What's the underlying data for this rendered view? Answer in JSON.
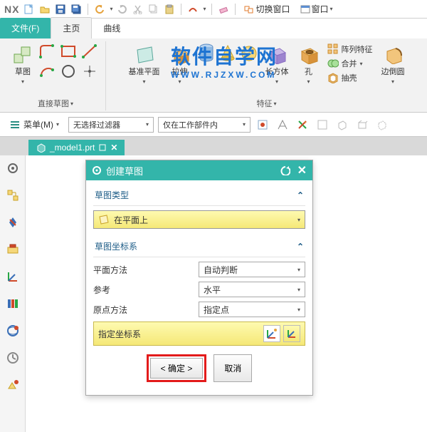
{
  "app": {
    "name": "NX"
  },
  "titlebar": {
    "switch_window": "切换窗口",
    "window_menu": "窗口"
  },
  "tabs": {
    "file": "文件(F)",
    "home": "主页",
    "curve": "曲线"
  },
  "ribbon": {
    "sketch": {
      "label": "草图",
      "direct_sketch": "直接草图"
    },
    "datum": {
      "label": "基准平面"
    },
    "extrude": {
      "label": "拉伸"
    },
    "cuboid": {
      "label": "长方体"
    },
    "hole": {
      "label": "孔"
    },
    "pattern": {
      "label": "阵列特征"
    },
    "union": {
      "label": "合并"
    },
    "shell": {
      "label": "抽壳"
    },
    "edge_blend": {
      "label": "边倒圆"
    },
    "group_feature": "特征"
  },
  "qbar": {
    "menu_label": "菜单(M)",
    "filter1": "无选择过滤器",
    "filter2": "仅在工作部件内"
  },
  "filetab": {
    "name": "_model1.prt"
  },
  "dialog": {
    "title": "创建草图",
    "section1": "草图类型",
    "type_value": "在平面上",
    "section2": "草图坐标系",
    "rows": {
      "plane_method": {
        "label": "平面方法",
        "value": "自动判断"
      },
      "reference": {
        "label": "参考",
        "value": "水平"
      },
      "origin_method": {
        "label": "原点方法",
        "value": "指定点"
      }
    },
    "spec_csys": "指定坐标系",
    "ok": "<  确定  >",
    "cancel": "取消"
  },
  "watermark": {
    "line1": "软件自学网",
    "line2": "WWW.RJZXW.COM"
  }
}
